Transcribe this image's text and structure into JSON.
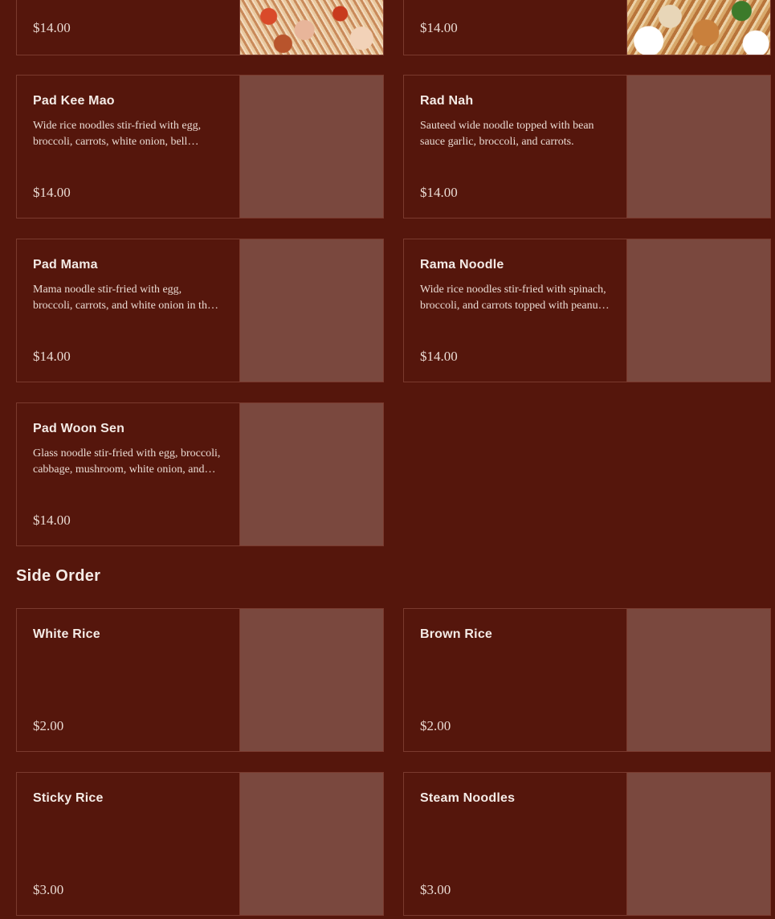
{
  "noodles_partial": [
    {
      "price": "$14.00",
      "photo": "noodle-photo"
    },
    {
      "price": "$14.00",
      "photo": "stirfry-photo"
    }
  ],
  "noodles": [
    {
      "name": "Pad Kee Mao",
      "description": "Wide rice noodles stir-fried with egg, broccoli, carrots, white onion, bell pepper, and basil.",
      "price": "$14.00"
    },
    {
      "name": "Rad Nah",
      "description": "Sauteed wide noodle topped with bean sauce garlic, broccoli, and carrots.",
      "price": "$14.00"
    },
    {
      "name": "Pad Mama",
      "description": "Mama noodle stir-fried with egg, broccoli, carrots, and white onion in the house sauce.",
      "price": "$14.00"
    },
    {
      "name": "Rama Noodle",
      "description": "Wide rice noodles stir-fried with spinach, broccoli, and carrots topped with peanut sauce.",
      "price": "$14.00"
    },
    {
      "name": "Pad Woon Sen",
      "description": "Glass noodle stir-fried with egg, broccoli, cabbage, mushroom, white onion, and carrots.",
      "price": "$14.00"
    }
  ],
  "side_order": {
    "title": "Side Order",
    "items": [
      {
        "name": "White Rice",
        "description": "",
        "price": "$2.00"
      },
      {
        "name": "Brown Rice",
        "description": "",
        "price": "$2.00"
      },
      {
        "name": "Sticky Rice",
        "description": "",
        "price": "$3.00"
      },
      {
        "name": "Steam Noodles",
        "description": "",
        "price": "$3.00"
      }
    ]
  },
  "colors": {
    "background": "#55160c",
    "card_border": "#7a3a2e",
    "image_placeholder": "#7a483e",
    "text": "#f1e6e0"
  }
}
